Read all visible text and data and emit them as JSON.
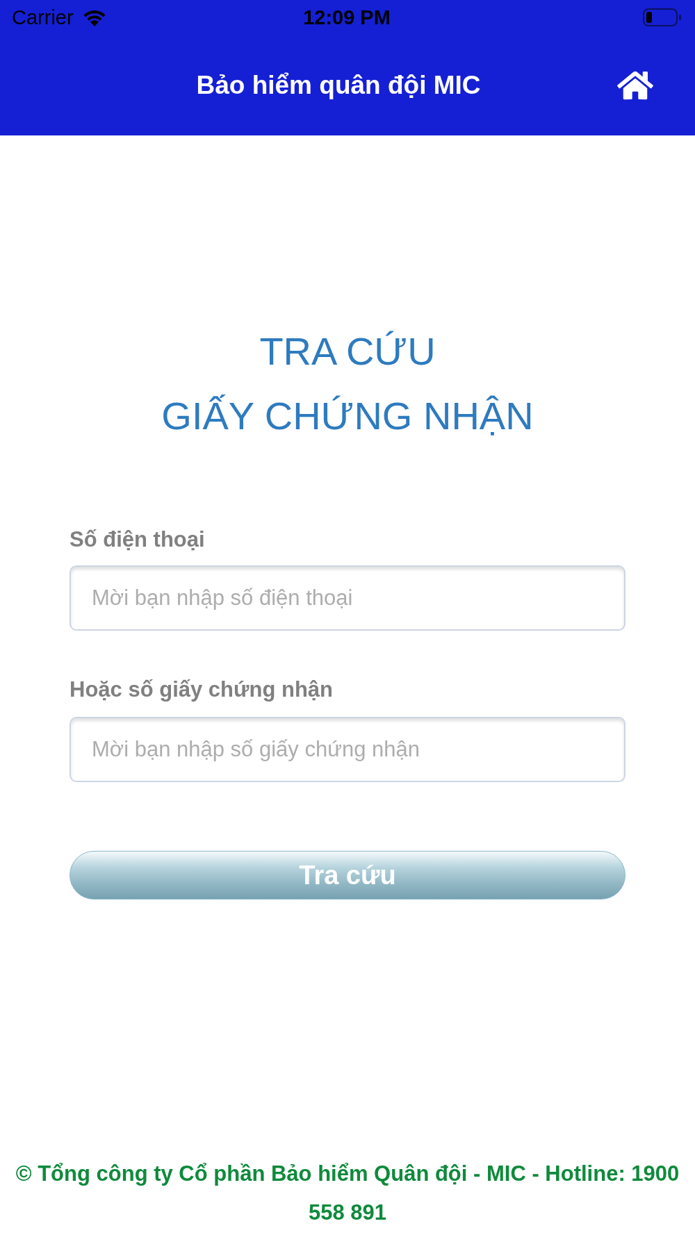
{
  "status_bar": {
    "carrier": "Carrier",
    "time": "12:09 PM"
  },
  "header": {
    "title": "Bảo hiểm quân đội MIC"
  },
  "heading": {
    "lines": [
      "TRA CỨU",
      "GIẤY CHỨNG NHẬN"
    ]
  },
  "fields": [
    {
      "label": "Số điện thoại",
      "placeholder": "Mời bạn nhập số điện thoại"
    },
    {
      "label": "Hoặc số giấy chứng nhận",
      "placeholder": "Mời bạn nhập số giấy chứng nhận"
    }
  ],
  "search_button": {
    "label": "Tra cứu"
  },
  "footer": {
    "text": "© Tổng công ty Cổ phần Bảo hiểm Quân đội - MIC - Hotline: 1900 558 891"
  }
}
